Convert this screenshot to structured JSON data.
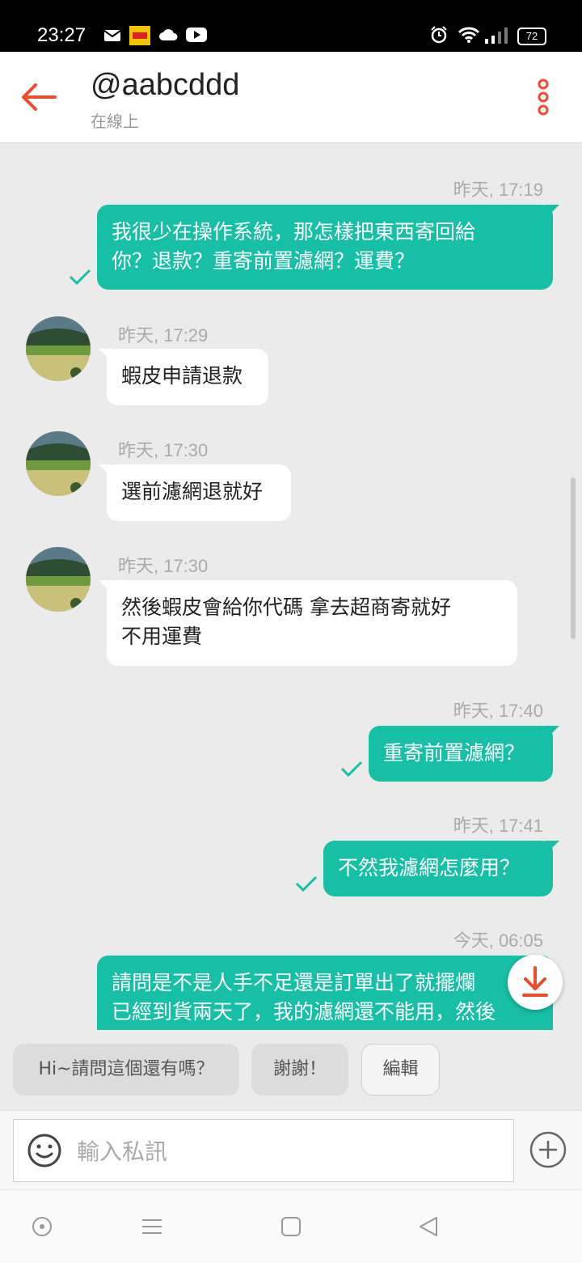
{
  "status_bar": {
    "time": "23:27",
    "battery": "72"
  },
  "header": {
    "title": "@aabcddd",
    "status": "在線上"
  },
  "messages": [
    {
      "dir": "out",
      "time": "昨天, 17:19",
      "lines": [
        "我很少在操作系統，那怎樣把東西寄回給",
        "你？退款？重寄前置濾網？運費？"
      ]
    },
    {
      "dir": "in",
      "time": "昨天, 17:29",
      "lines": [
        "蝦皮申請退款"
      ]
    },
    {
      "dir": "in",
      "time": "昨天, 17:30",
      "lines": [
        "選前濾網退就好"
      ]
    },
    {
      "dir": "in",
      "time": "昨天, 17:30",
      "lines": [
        "然後蝦皮會給你代碼 拿去超商寄就好",
        "不用運費"
      ]
    },
    {
      "dir": "out",
      "time": "昨天, 17:40",
      "lines": [
        "重寄前置濾網？"
      ]
    },
    {
      "dir": "out",
      "time": "昨天, 17:41",
      "lines": [
        "不然我濾網怎麼用？"
      ]
    },
    {
      "dir": "out",
      "time": "今天, 06:05",
      "lines": [
        "請問是不是人手不足還是訂單出了就擺爛",
        "已經到貨兩天了，我的濾網還不能用，然後"
      ]
    }
  ],
  "quick_replies": [
    "Hi~請問這個還有嗎？",
    "謝謝！",
    "編輯"
  ],
  "input": {
    "placeholder": "輸入私訊"
  },
  "colors": {
    "accent": "#ee4d2d",
    "outgoing_bubble": "#17bfa4",
    "background": "#ebebeb"
  }
}
